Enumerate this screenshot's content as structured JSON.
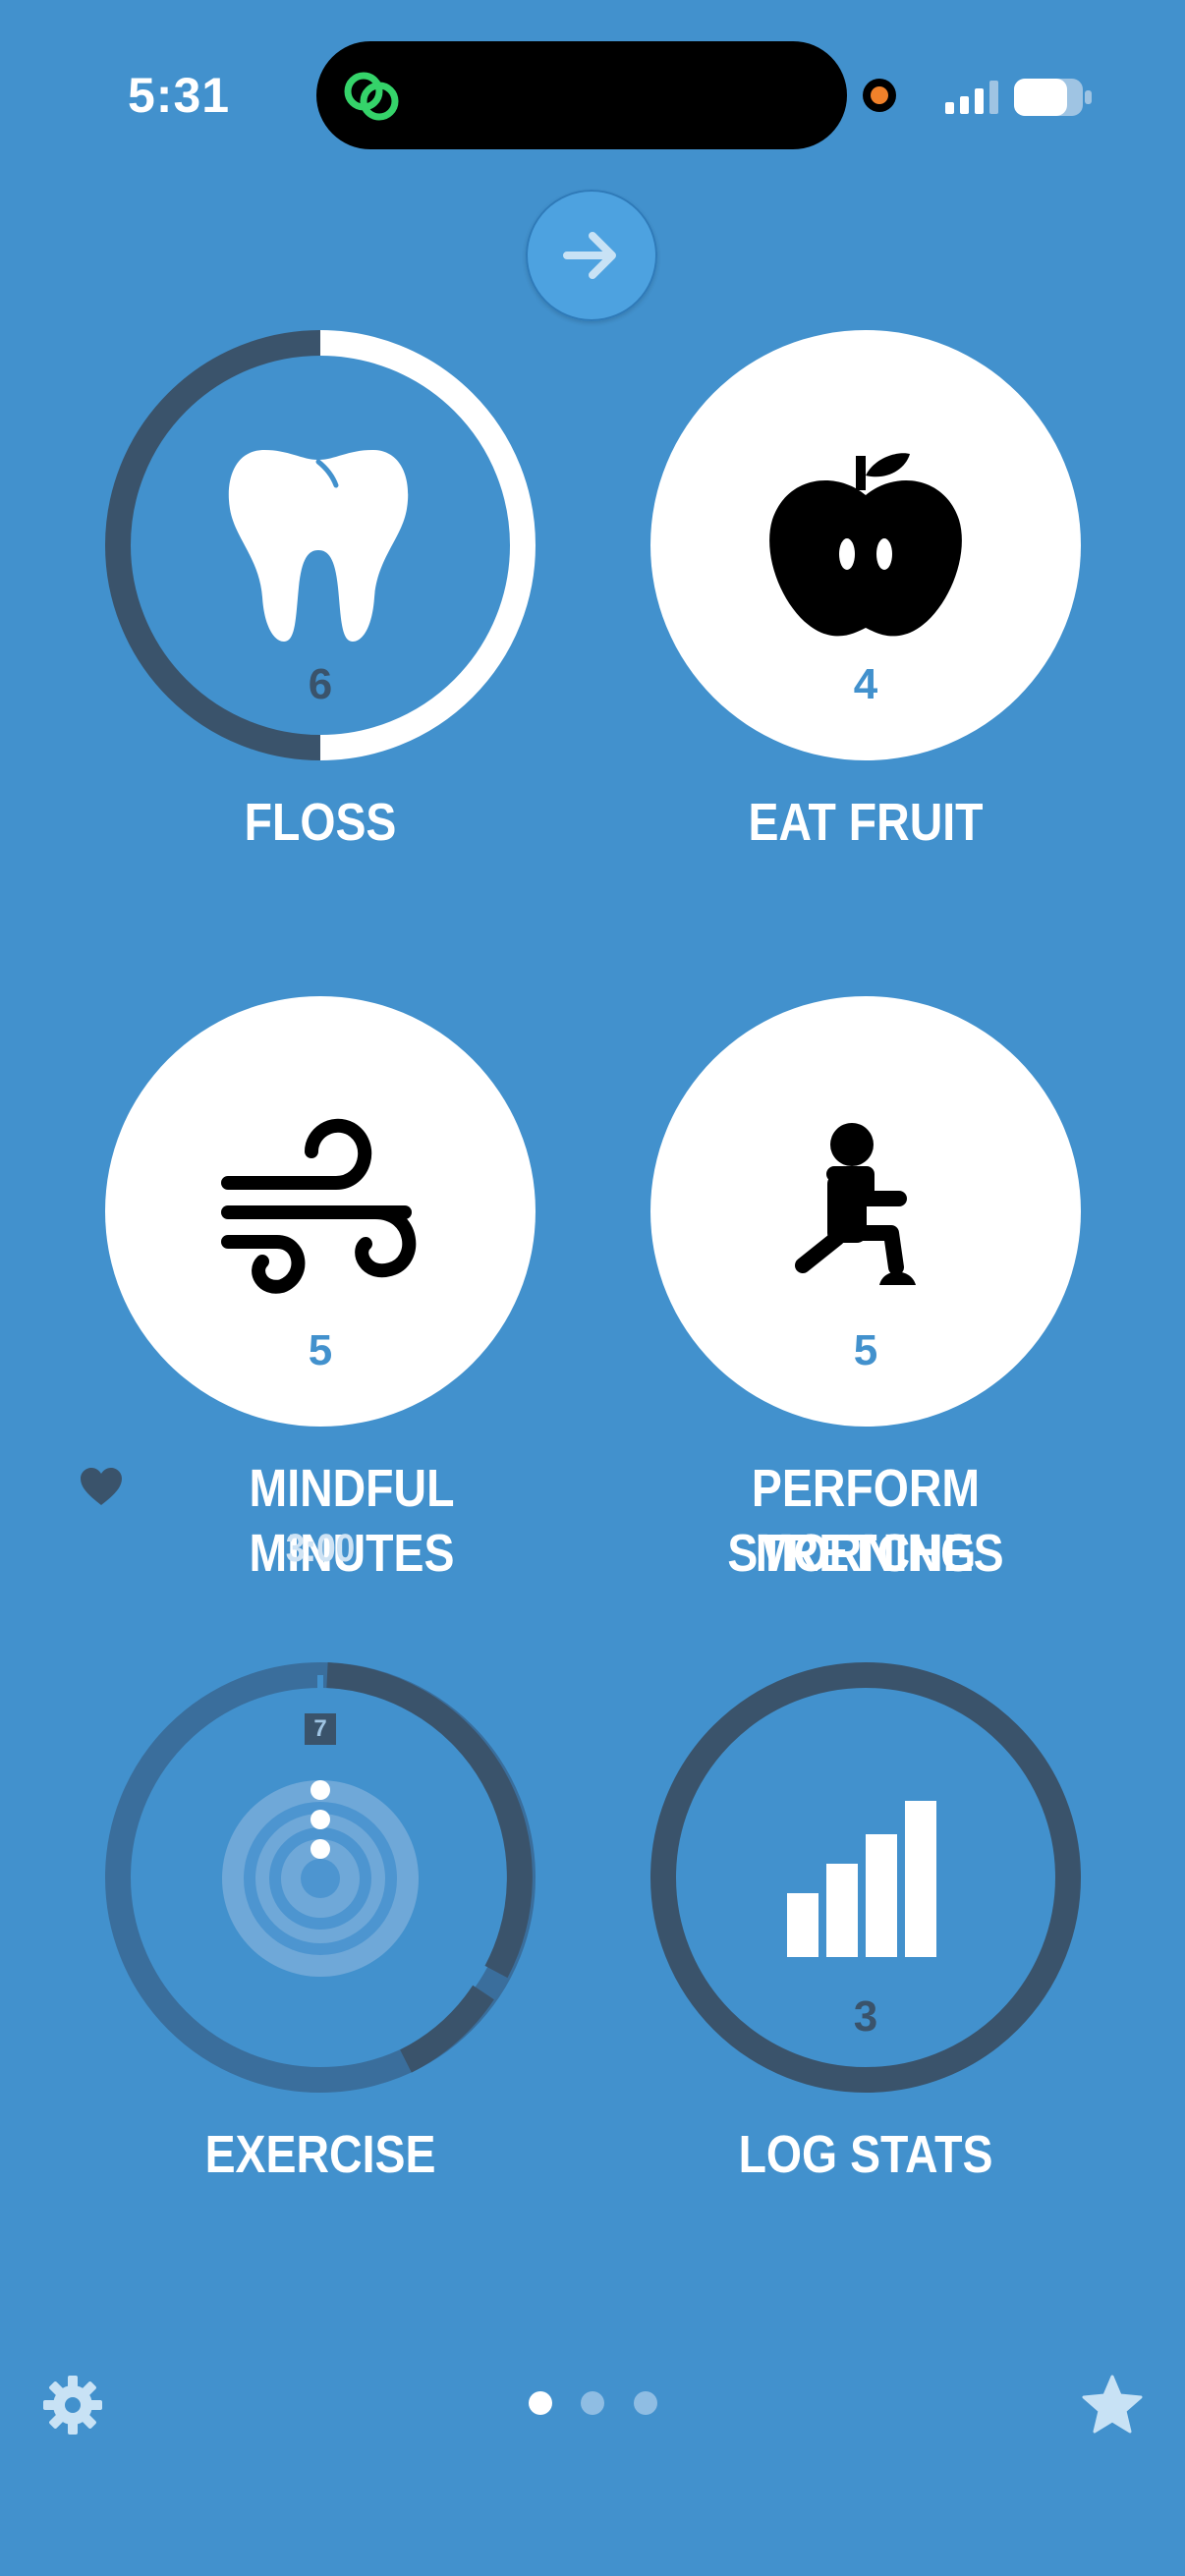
{
  "status_bar": {
    "time": "5:31"
  },
  "habits": [
    {
      "label": "FLOSS",
      "count": "6",
      "icon": "tooth-icon"
    },
    {
      "label": "EAT FRUIT",
      "count": "4",
      "icon": "apple-icon"
    },
    {
      "label": "MINDFUL MINUTES",
      "count": "5",
      "icon": "wind-icon",
      "subtitle": "3:00"
    },
    {
      "label_line1": "PERFORM MORNING",
      "label_line2": "STRETCHES",
      "count": "5",
      "icon": "stretch-icon"
    },
    {
      "label": "EXERCISE",
      "count": "7",
      "icon": "target-icon"
    },
    {
      "label": "LOG STATS",
      "count": "3",
      "icon": "bar-chart-icon"
    }
  ],
  "pager": {
    "pages": 3,
    "current": 0
  },
  "colors": {
    "background": "#4291CD",
    "ring_dark": "#3A536B",
    "ring_light": "#FFFFFF",
    "count_blue": "#4291CD",
    "count_dark": "#3A536B"
  }
}
